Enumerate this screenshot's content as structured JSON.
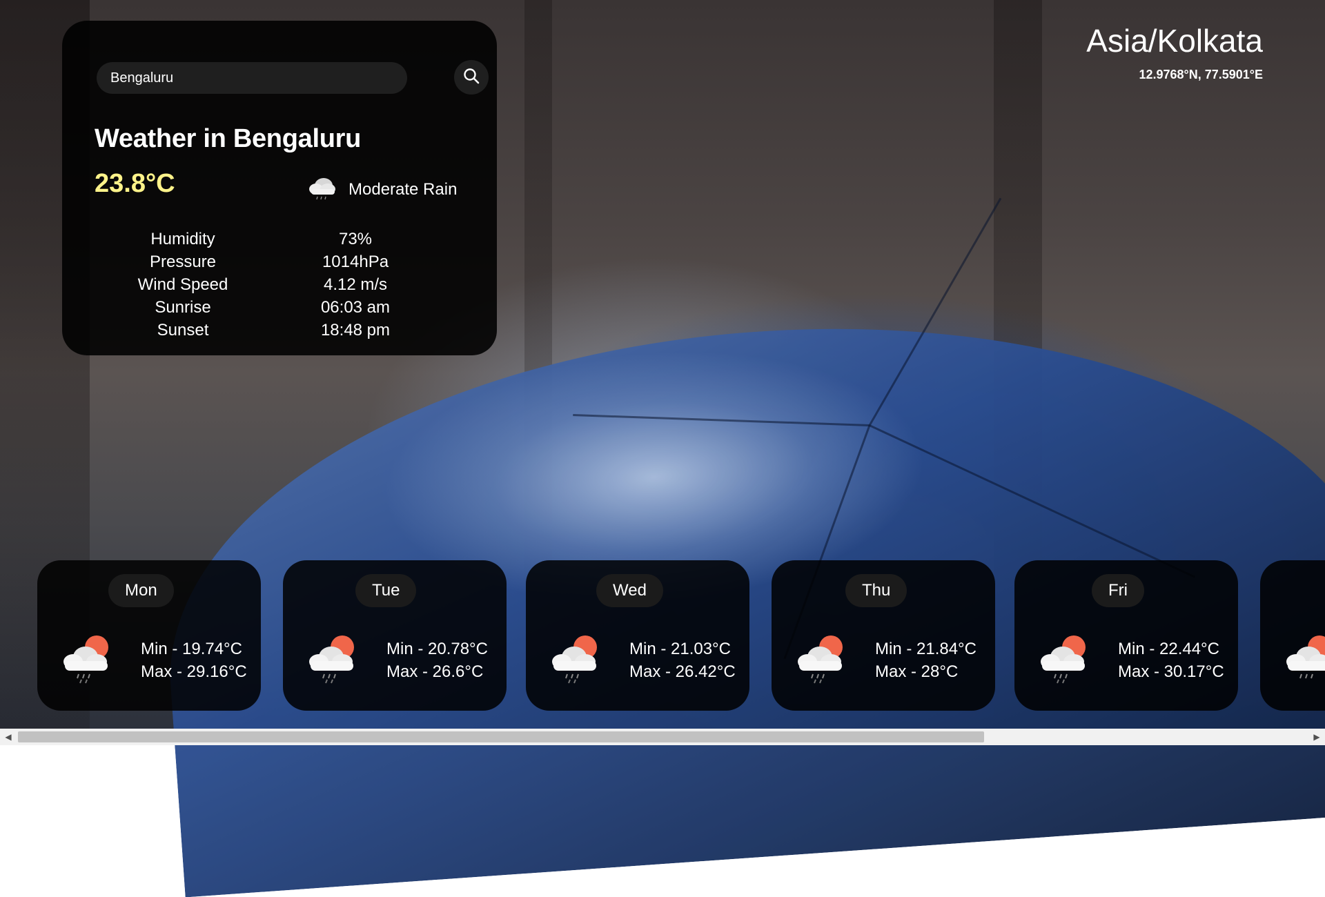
{
  "search": {
    "value": "Bengaluru"
  },
  "weather": {
    "title": "Weather in Bengaluru",
    "temperature": "23.8°C",
    "condition": "Moderate Rain",
    "stats": [
      {
        "label": "Humidity",
        "value": "73%"
      },
      {
        "label": "Pressure",
        "value": "1014hPa"
      },
      {
        "label": "Wind Speed",
        "value": "4.12 m/s"
      },
      {
        "label": "Sunrise",
        "value": "06:03 am"
      },
      {
        "label": "Sunset",
        "value": "18:48 pm"
      }
    ]
  },
  "location": {
    "timezone": "Asia/Kolkata",
    "coordinates": "12.9768°N, 77.5901°E"
  },
  "forecast": [
    {
      "day": "Mon",
      "min": "Min - 19.74°C",
      "max": "Max - 29.16°C",
      "icon": "sun-cloud-rain-icon"
    },
    {
      "day": "Tue",
      "min": "Min - 20.78°C",
      "max": "Max - 26.6°C",
      "icon": "sun-cloud-rain-icon"
    },
    {
      "day": "Wed",
      "min": "Min - 21.03°C",
      "max": "Max - 26.42°C",
      "icon": "sun-cloud-rain-icon"
    },
    {
      "day": "Thu",
      "min": "Min - 21.84°C",
      "max": "Max - 28°C",
      "icon": "sun-cloud-rain-icon"
    },
    {
      "day": "Fri",
      "min": "Min - 22.44°C",
      "max": "Max - 30.17°C",
      "icon": "sun-cloud-rain-icon"
    }
  ],
  "colors": {
    "temperature": "#fff38a",
    "card_bg": "#000000",
    "sun": "#f0664a"
  }
}
